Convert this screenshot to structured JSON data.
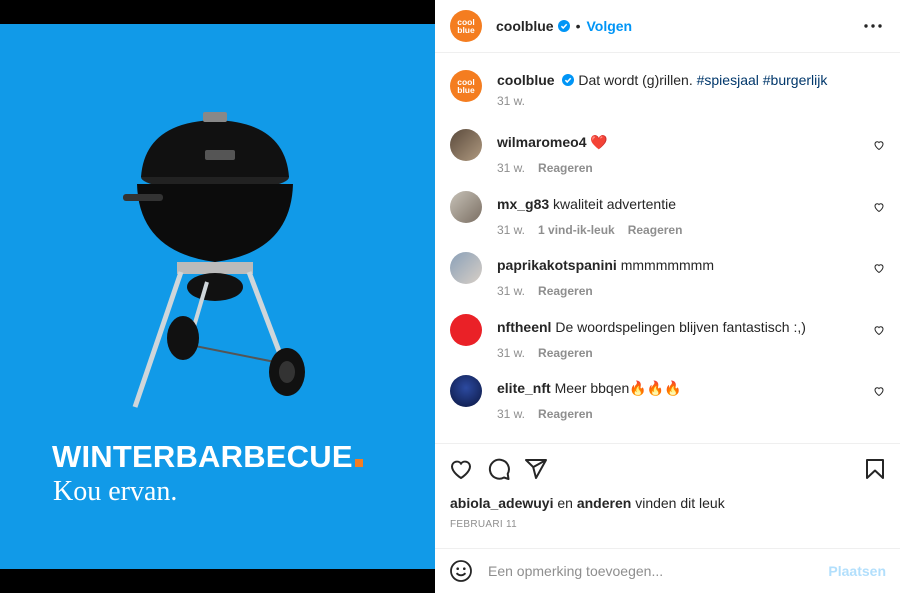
{
  "media": {
    "headline": "WINTERBARBECUE",
    "subline": "Kou ervan."
  },
  "header": {
    "username": "coolblue",
    "avatar_text_top": "cool",
    "avatar_text_bottom": "blue",
    "separator": "•",
    "follow_label": "Volgen"
  },
  "caption": {
    "username": "coolblue",
    "text": "Dat wordt (g)rillen.",
    "hashtags": [
      "#spiesjaal",
      "#burgerlijk"
    ],
    "time": "31 w."
  },
  "comments": [
    {
      "username": "wilmaromeo4",
      "text": "❤️",
      "time": "31 w.",
      "likes": "",
      "reply": "Reageren"
    },
    {
      "username": "mx_g83",
      "text": "kwaliteit advertentie",
      "time": "31 w.",
      "likes": "1 vind-ik-leuk",
      "reply": "Reageren"
    },
    {
      "username": "paprikakotspanini",
      "text": "mmmmmmmm",
      "time": "31 w.",
      "likes": "",
      "reply": "Reageren"
    },
    {
      "username": "nftheenl",
      "text": "De woordspelingen blijven fantastisch :,)",
      "time": "31 w.",
      "likes": "",
      "reply": "Reageren"
    },
    {
      "username": "elite_nft",
      "text": "Meer bbqen🔥🔥🔥",
      "time": "31 w.",
      "likes": "",
      "reply": "Reageren"
    }
  ],
  "likes": {
    "user": "abiola_adewuyi",
    "middle": "en",
    "others": "anderen",
    "suffix": "vinden dit leuk"
  },
  "date": "FEBRUARI 11",
  "add_comment": {
    "placeholder": "Een opmerking toevoegen...",
    "post_label": "Plaatsen"
  },
  "colors": {
    "brand_orange": "#f47d20",
    "media_blue": "#119ae8",
    "link_blue": "#0095f6",
    "muted": "#8e8e8e"
  }
}
